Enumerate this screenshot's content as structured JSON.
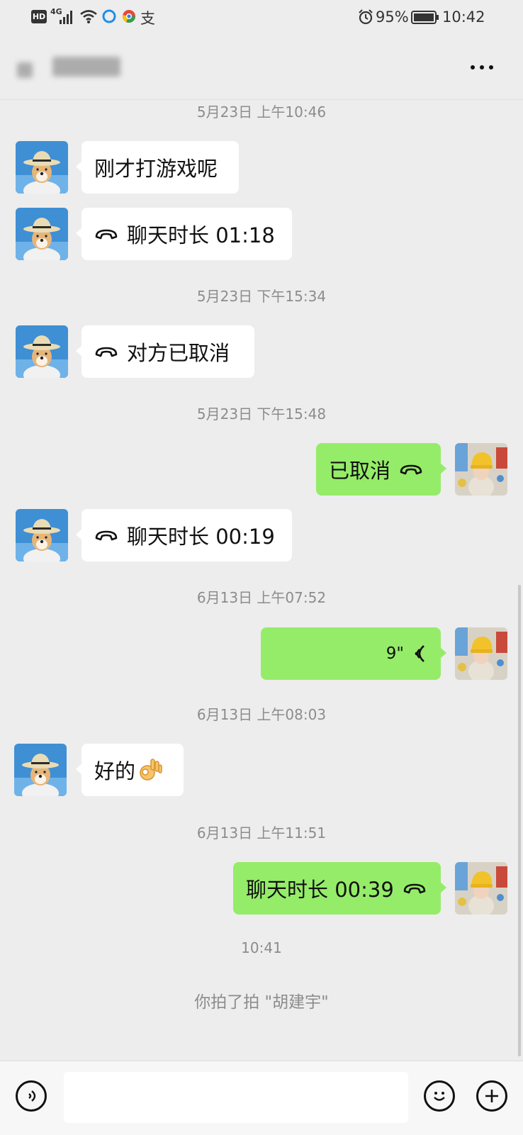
{
  "status_bar": {
    "hd": "HD",
    "network": "4G",
    "battery": "95%",
    "time": "10:42"
  },
  "nav": {
    "back_icon": "back-arrow-icon",
    "more_icon": "more-icon"
  },
  "messages": {
    "ts1": "5月23日 上午10:46",
    "m1": "刚才打游戏呢",
    "m2": "聊天时长 01:18",
    "ts2": "5月23日 下午15:34",
    "m3": "对方已取消",
    "ts3": "5月23日 下午15:48",
    "m4": "已取消",
    "m5": "聊天时长 00:19",
    "ts4": "6月13日 上午07:52",
    "m6": "9\"",
    "ts5": "6月13日 上午08:03",
    "m7": "好的",
    "ts6": "6月13日 上午11:51",
    "m8": "聊天时长 00:39",
    "ts7": "10:41",
    "pat": "你拍了拍 \"胡建宇\""
  },
  "input_bar": {
    "voice_icon": "voice-icon",
    "emoji_icon": "emoji-icon",
    "plus_icon": "plus-icon",
    "input_value": ""
  },
  "colors": {
    "background": "#ededed",
    "outgoing_bubble": "#95ec69",
    "incoming_bubble": "#ffffff",
    "timestamp": "#8c8c8c"
  }
}
